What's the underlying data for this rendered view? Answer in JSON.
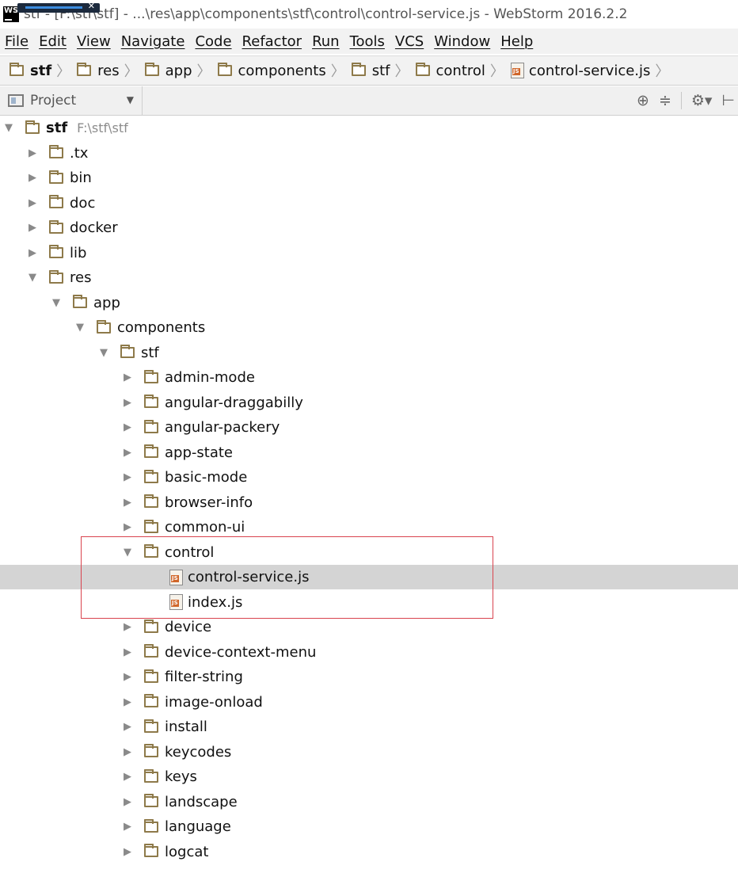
{
  "window": {
    "title": "stf - [F:\\stf\\stf] - ...\\res\\app\\components\\stf\\control\\control-service.js - WebStorm 2016.2.2",
    "logo": "WS"
  },
  "menu": [
    "File",
    "Edit",
    "View",
    "Navigate",
    "Code",
    "Refactor",
    "Run",
    "Tools",
    "VCS",
    "Window",
    "Help"
  ],
  "breadcrumb": [
    {
      "label": "stf",
      "type": "folder"
    },
    {
      "label": "res",
      "type": "folder"
    },
    {
      "label": "app",
      "type": "folder"
    },
    {
      "label": "components",
      "type": "folder"
    },
    {
      "label": "stf",
      "type": "folder"
    },
    {
      "label": "control",
      "type": "folder"
    },
    {
      "label": "control-service.js",
      "type": "js"
    }
  ],
  "toolwindow": {
    "label": "Project",
    "icons": [
      "locate-icon",
      "collapse-all-icon",
      "gear-icon"
    ]
  },
  "tree": [
    {
      "label": "stf",
      "depth": 0,
      "expanded": true,
      "type": "folder",
      "path": "F:\\stf\\stf"
    },
    {
      "label": ".tx",
      "depth": 1,
      "expanded": false,
      "type": "folder"
    },
    {
      "label": "bin",
      "depth": 1,
      "expanded": false,
      "type": "folder"
    },
    {
      "label": "doc",
      "depth": 1,
      "expanded": false,
      "type": "folder"
    },
    {
      "label": "docker",
      "depth": 1,
      "expanded": false,
      "type": "folder"
    },
    {
      "label": "lib",
      "depth": 1,
      "expanded": false,
      "type": "folder"
    },
    {
      "label": "res",
      "depth": 1,
      "expanded": true,
      "type": "folder"
    },
    {
      "label": "app",
      "depth": 2,
      "expanded": true,
      "type": "folder"
    },
    {
      "label": "components",
      "depth": 3,
      "expanded": true,
      "type": "folder"
    },
    {
      "label": "stf",
      "depth": 4,
      "expanded": true,
      "type": "folder"
    },
    {
      "label": "admin-mode",
      "depth": 5,
      "expanded": false,
      "type": "folder"
    },
    {
      "label": "angular-draggabilly",
      "depth": 5,
      "expanded": false,
      "type": "folder"
    },
    {
      "label": "angular-packery",
      "depth": 5,
      "expanded": false,
      "type": "folder"
    },
    {
      "label": "app-state",
      "depth": 5,
      "expanded": false,
      "type": "folder"
    },
    {
      "label": "basic-mode",
      "depth": 5,
      "expanded": false,
      "type": "folder"
    },
    {
      "label": "browser-info",
      "depth": 5,
      "expanded": false,
      "type": "folder"
    },
    {
      "label": "common-ui",
      "depth": 5,
      "expanded": false,
      "type": "folder"
    },
    {
      "label": "control",
      "depth": 5,
      "expanded": true,
      "type": "folder"
    },
    {
      "label": "control-service.js",
      "depth": 6,
      "type": "js",
      "selected": true
    },
    {
      "label": "index.js",
      "depth": 6,
      "type": "js"
    },
    {
      "label": "device",
      "depth": 5,
      "expanded": false,
      "type": "folder"
    },
    {
      "label": "device-context-menu",
      "depth": 5,
      "expanded": false,
      "type": "folder"
    },
    {
      "label": "filter-string",
      "depth": 5,
      "expanded": false,
      "type": "folder"
    },
    {
      "label": "image-onload",
      "depth": 5,
      "expanded": false,
      "type": "folder"
    },
    {
      "label": "install",
      "depth": 5,
      "expanded": false,
      "type": "folder"
    },
    {
      "label": "keycodes",
      "depth": 5,
      "expanded": false,
      "type": "folder"
    },
    {
      "label": "keys",
      "depth": 5,
      "expanded": false,
      "type": "folder"
    },
    {
      "label": "landscape",
      "depth": 5,
      "expanded": false,
      "type": "folder"
    },
    {
      "label": "language",
      "depth": 5,
      "expanded": false,
      "type": "folder"
    },
    {
      "label": "logcat",
      "depth": 5,
      "expanded": false,
      "type": "folder"
    }
  ]
}
